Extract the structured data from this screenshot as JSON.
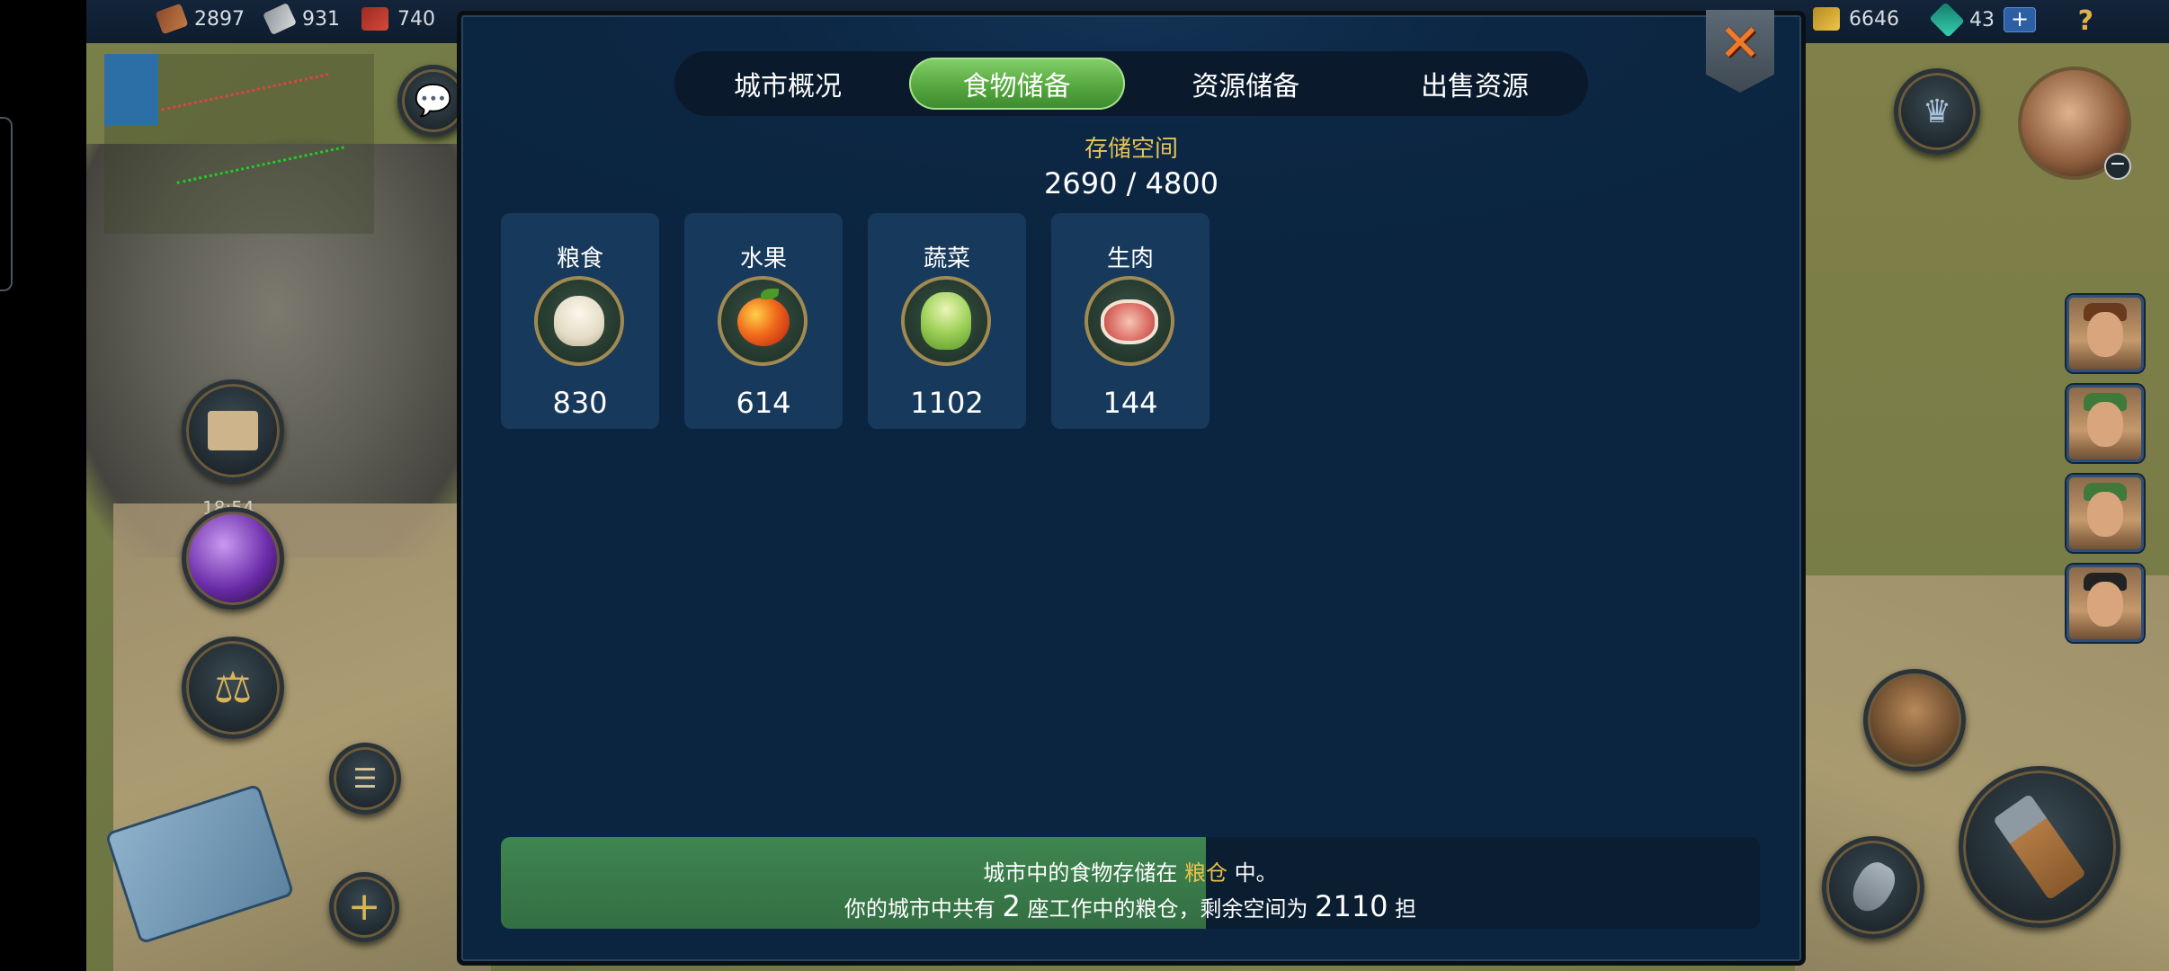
{
  "topbar": {
    "left_resources": [
      {
        "name": "wood-icon",
        "value": "2897"
      },
      {
        "name": "iron-icon",
        "value": "931"
      },
      {
        "name": "brick-icon",
        "value": "740"
      }
    ],
    "right_resources": [
      {
        "name": "gold-icon",
        "value": "6646"
      },
      {
        "name": "gem-icon",
        "value": "43"
      }
    ],
    "plus_label": "+",
    "help_label": "?"
  },
  "hud": {
    "timer": "18:54",
    "add_label": "+"
  },
  "panel": {
    "tabs": [
      "城市概况",
      "食物储备",
      "资源储备",
      "出售资源"
    ],
    "active_tab": 1,
    "storage_title": "存储空间",
    "storage_value": "2690 / 4800",
    "storage_used": 2690,
    "storage_capacity": 4800,
    "foods": [
      {
        "name": "粮食",
        "amount": "830",
        "icon": "grain-sack-icon"
      },
      {
        "name": "水果",
        "amount": "614",
        "icon": "apple-icon"
      },
      {
        "name": "蔬菜",
        "amount": "1102",
        "icon": "cabbage-icon"
      },
      {
        "name": "生肉",
        "amount": "144",
        "icon": "raw-meat-icon"
      }
    ],
    "info": {
      "fill_fraction": 0.56,
      "line1_prefix": "城市中的食物存储在 ",
      "line1_highlight": "粮仓",
      "line1_suffix": " 中。",
      "line2_part1": "你的城市中共有 ",
      "line2_count": "2",
      "line2_part2": " 座工作中的粮仓，剩余空间为 ",
      "line2_remaining": "2110",
      "line2_unit": " 担"
    },
    "close_symbol": "✕"
  },
  "colors": {
    "accent_gold": "#e4c35a",
    "tab_active_green": "#55a83f",
    "panel_bg": "#0c2744"
  }
}
